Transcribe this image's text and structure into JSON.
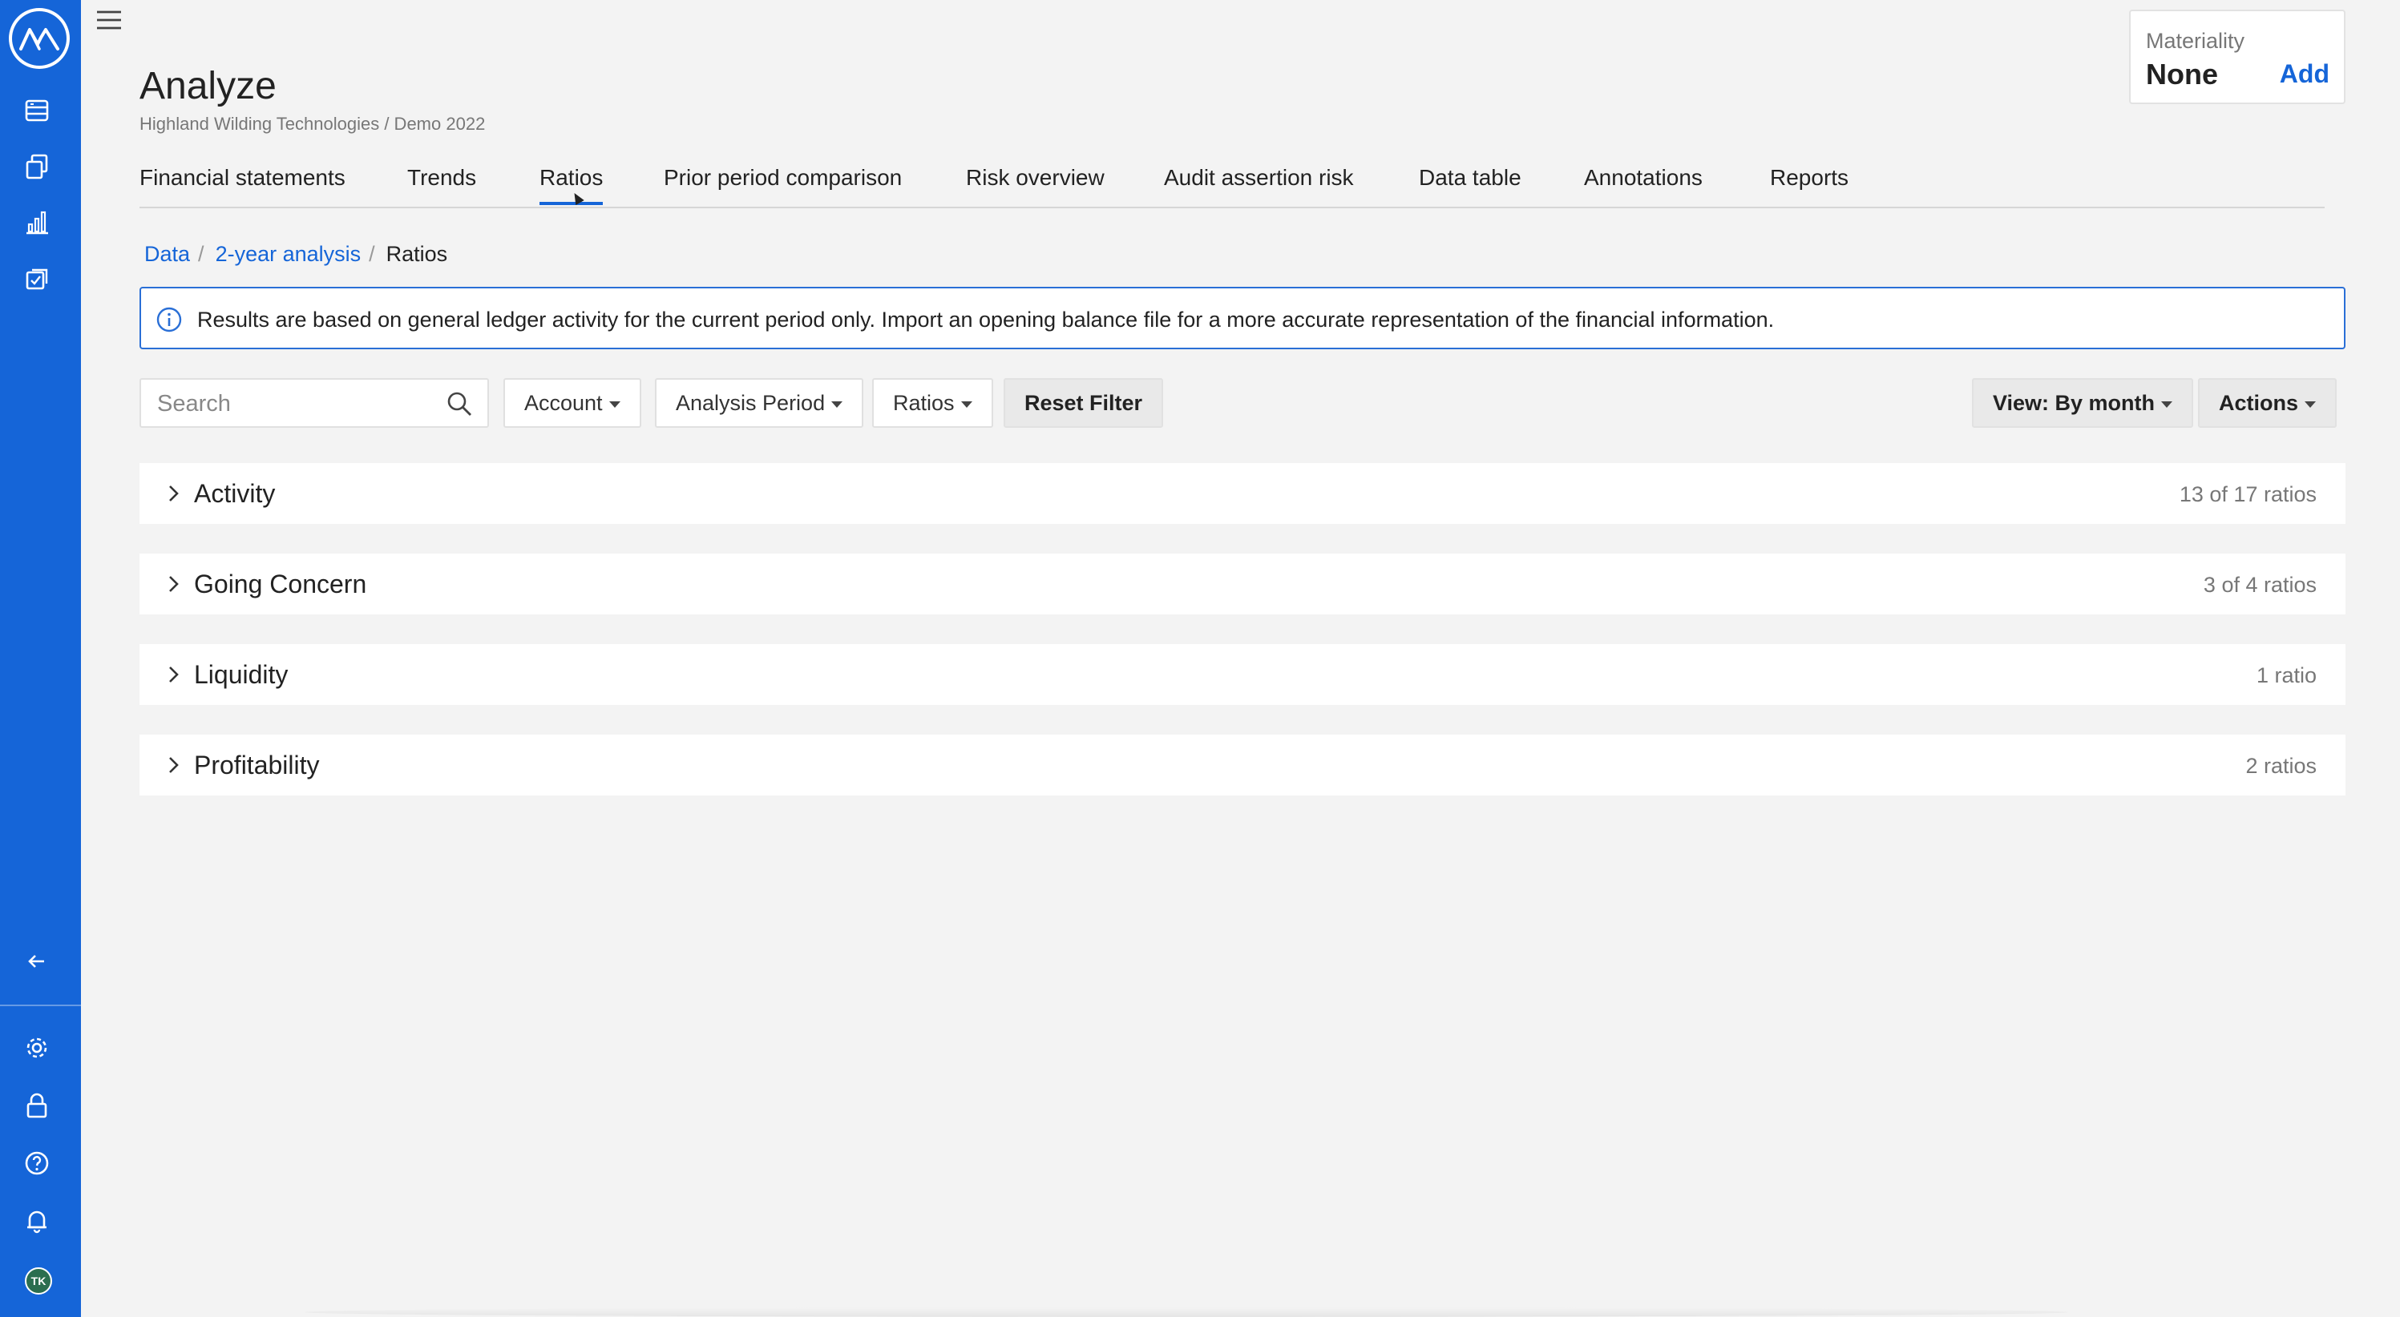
{
  "app": {
    "page_title": "Analyze",
    "subtitle": "Highland Wilding Technologies / Demo 2022",
    "accent_color": "#1565d8"
  },
  "rail": {
    "top_icons": [
      "data-icon",
      "documents-icon",
      "bar-chart-icon",
      "tasks-icon"
    ],
    "collapse_icon": "arrow-left-icon",
    "bottom_icons": [
      "settings-icon",
      "lock-icon",
      "help-icon",
      "bell-icon"
    ],
    "avatar_initials": "TK"
  },
  "materiality": {
    "label": "Materiality",
    "value": "None",
    "add_label": "Add"
  },
  "tabs": [
    {
      "label": "Financial statements",
      "active": false
    },
    {
      "label": "Trends",
      "active": false
    },
    {
      "label": "Ratios",
      "active": true
    },
    {
      "label": "Prior period comparison",
      "active": false
    },
    {
      "label": "Risk overview",
      "active": false
    },
    {
      "label": "Audit assertion risk",
      "active": false
    },
    {
      "label": "Data table",
      "active": false
    },
    {
      "label": "Annotations",
      "active": false
    },
    {
      "label": "Reports",
      "active": false
    }
  ],
  "breadcrumb": {
    "items": [
      "Data",
      "2-year analysis"
    ],
    "current": "Ratios",
    "separator": "/"
  },
  "info_banner": {
    "text": "Results are based on general ledger activity for the current period only. Import an opening balance file for a more accurate representation of the financial information."
  },
  "toolbar": {
    "search_placeholder": "Search",
    "search_value": "",
    "account_label": "Account",
    "analysis_period_label": "Analysis Period",
    "ratios_label": "Ratios",
    "reset_label": "Reset Filter",
    "view_label": "View: By month",
    "actions_label": "Actions"
  },
  "groups": [
    {
      "name": "Activity",
      "count": "13 of 17 ratios"
    },
    {
      "name": "Going Concern",
      "count": "3 of 4 ratios"
    },
    {
      "name": "Liquidity",
      "count": "1 ratio"
    },
    {
      "name": "Profitability",
      "count": "2 ratios"
    }
  ]
}
